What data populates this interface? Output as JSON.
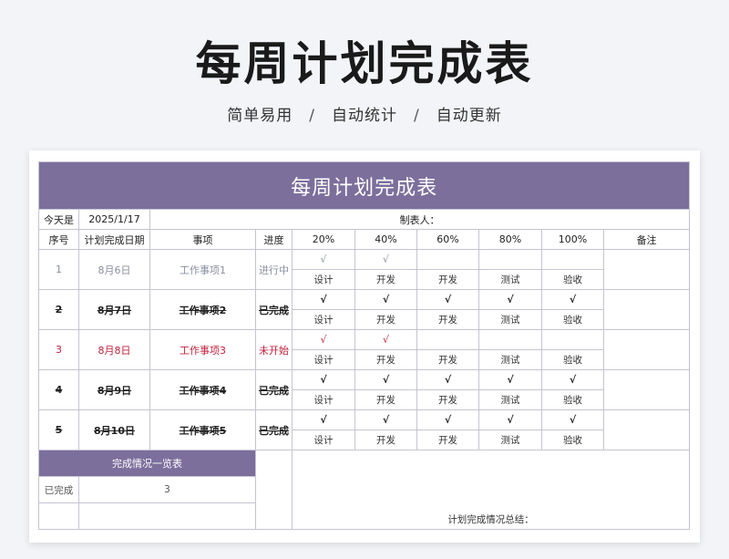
{
  "hero": {
    "title": "每周计划完成表",
    "subtitle": [
      "简单易用",
      "自动统计",
      "自动更新"
    ],
    "separator": "/"
  },
  "sheet": {
    "title": "每周计划完成表",
    "today_label": "今天是",
    "today_value": "2025/1/17",
    "maker_label": "制表人：",
    "columns": [
      "序号",
      "计划完成日期",
      "事项",
      "进度",
      "20%",
      "40%",
      "60%",
      "80%",
      "100%",
      "备注"
    ],
    "rows": [
      {
        "id": "1",
        "date": "8月6日",
        "item": "工作事项1",
        "status": "进行中",
        "style": "gray",
        "marks": [
          "√",
          "√",
          "",
          "",
          ""
        ],
        "stages": [
          "设计",
          "开发",
          "开发",
          "测试",
          "验收"
        ]
      },
      {
        "id": "2",
        "date": "8月7日",
        "item": "工作事项2",
        "status": "已完成",
        "style": "done",
        "marks": [
          "√",
          "√",
          "√",
          "√",
          "√"
        ],
        "stages": [
          "设计",
          "开发",
          "开发",
          "测试",
          "验收"
        ]
      },
      {
        "id": "3",
        "date": "8月8日",
        "item": "工作事项3",
        "status": "未开始",
        "style": "red",
        "marks": [
          "√",
          "√",
          "",
          "",
          ""
        ],
        "stages": [
          "设计",
          "开发",
          "开发",
          "测试",
          "验收"
        ]
      },
      {
        "id": "4",
        "date": "8月9日",
        "item": "工作事项4",
        "status": "已完成",
        "style": "done",
        "marks": [
          "√",
          "√",
          "√",
          "√",
          "√"
        ],
        "stages": [
          "设计",
          "开发",
          "开发",
          "测试",
          "验收"
        ]
      },
      {
        "id": "5",
        "date": "8月10日",
        "item": "工作事项5",
        "status": "已完成",
        "style": "done",
        "marks": [
          "√",
          "√",
          "√",
          "√",
          "√"
        ],
        "stages": [
          "设计",
          "开发",
          "开发",
          "测试",
          "验收"
        ]
      }
    ],
    "summary_title": "完成情况一览表",
    "summary_rows": [
      {
        "label": "已完成",
        "value": "3"
      }
    ],
    "summary_footer": "计划完成情况总结："
  }
}
